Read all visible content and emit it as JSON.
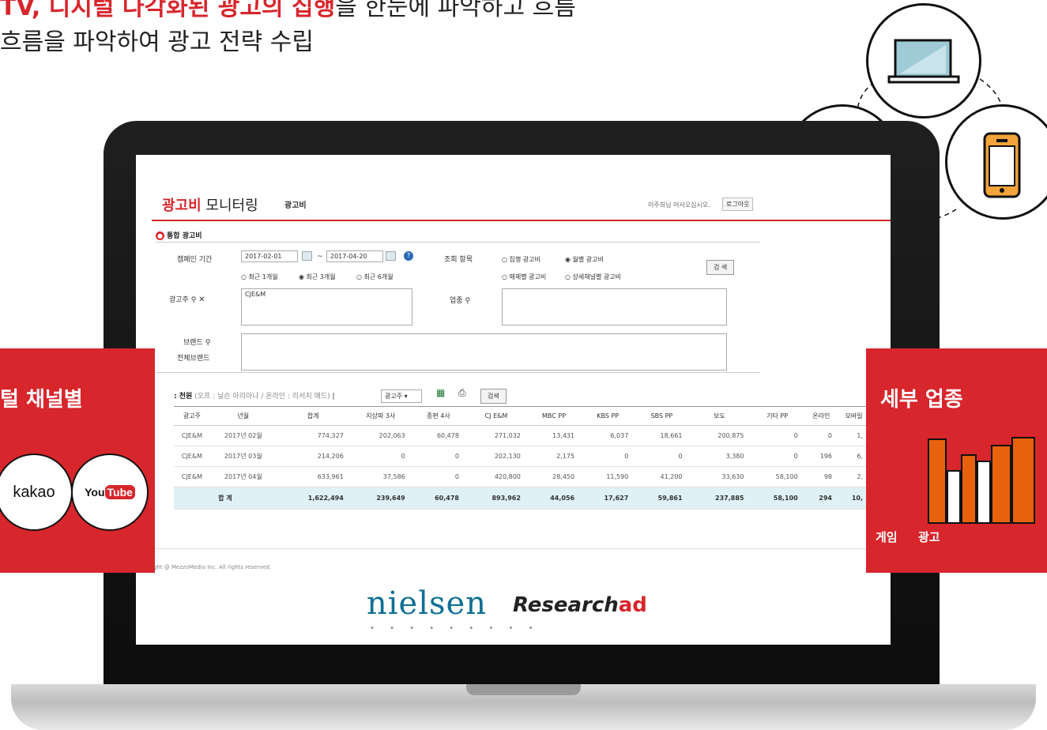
{
  "headline": {
    "line1_prefix": "",
    "line1_highlight": "TV, 디지털 다각화된 광고의 집행",
    "line1_suffix": "을 한눈에 파악하고 흐름",
    "line2": "흐름을 파악하여 광고 전략 수립"
  },
  "app": {
    "brand_highlight": "광고비",
    "brand_rest": " 모니터링",
    "nav_item": "광고비",
    "welcome_text": "이주희님 어서오십시오.",
    "logout_label": "로그아웃",
    "section_title": "통합 광고비"
  },
  "filters": {
    "campaign_period_label": "캠페인 기간",
    "start_date": "2017-02-01",
    "range_sep": "~",
    "end_date": "2017-04-20",
    "period_options": [
      "최근 1개월",
      "최근 3개월",
      "최근 6개월"
    ],
    "period_selected": "최근 3개월",
    "query_label": "조회 항목",
    "query_options": [
      "집행 광고비",
      "월별 광고비",
      "매체별 광고비",
      "상세채널별 광고비"
    ],
    "query_selected": "월별 광고비",
    "search_button": "검 색",
    "advertiser_label": "광고주",
    "advertiser_value": "CJE&M",
    "industry_label": "업종",
    "brand_label": "브랜드",
    "all_brand_label": "전체브랜드"
  },
  "results": {
    "unit_label": ": 천원",
    "unit_note": "(오프 : 닐슨 아리아나 / 온라인 : 리서치 애드)",
    "sort_select": "광고주",
    "search_button": "검색",
    "columns": [
      "광고주",
      "년월",
      "합계",
      "지상파 3사",
      "종편 4사",
      "CJ E&M",
      "MBC PP",
      "KBS PP",
      "SBS PP",
      "보도",
      "기타 PP",
      "온라인",
      "모바일"
    ],
    "rows": [
      [
        "CJE&M",
        "2017년 02월",
        "774,327",
        "202,063",
        "60,478",
        "271,032",
        "13,431",
        "6,037",
        "18,661",
        "200,875",
        "0",
        "0",
        "1,"
      ],
      [
        "CJE&M",
        "2017년 03월",
        "214,206",
        "0",
        "0",
        "202,130",
        "2,175",
        "0",
        "0",
        "3,380",
        "0",
        "196",
        "6,"
      ],
      [
        "CJE&M",
        "2017년 04월",
        "633,961",
        "37,586",
        "0",
        "420,800",
        "28,450",
        "11,590",
        "41,200",
        "33,630",
        "58,100",
        "98",
        "2,"
      ]
    ],
    "total_label": "합 계",
    "total_row": [
      "1,622,494",
      "239,649",
      "60,478",
      "893,962",
      "44,056",
      "17,627",
      "59,861",
      "237,885",
      "58,100",
      "294",
      "10,"
    ]
  },
  "footer": {
    "copyright": "ight @ MezzoMedia Inc. All rights reserved.",
    "nielsen": "nielsen",
    "research_prefix": "Research",
    "research_suffix": "ad"
  },
  "left_panel": {
    "title": "털 채널별",
    "logo1": "kakao",
    "logo2_you": "You",
    "logo2_tube": "Tube"
  },
  "right_panel": {
    "title": "세부 업종",
    "cat1": "게임",
    "cat2": "광고"
  },
  "colors": {
    "accent_red": "#d7262c",
    "orange": "#e8620e",
    "total_row_bg": "#dff0f6"
  }
}
